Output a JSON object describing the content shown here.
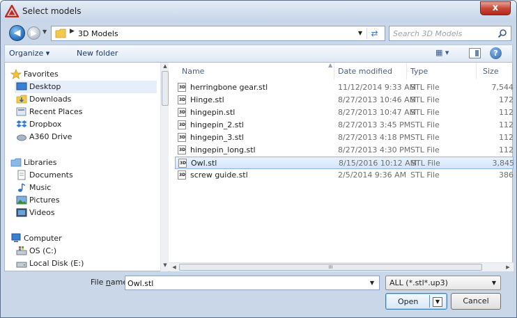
{
  "window": {
    "title": "Select models",
    "close_label": "x"
  },
  "address": {
    "path": "3D Models",
    "search_placeholder": "Search 3D Models"
  },
  "toolbar": {
    "organize_label": "Organize ▾",
    "newfolder_label": "New folder",
    "views_label": "▦ ▾"
  },
  "nav": {
    "favorites_label": "Favorites",
    "favorites": [
      "Desktop",
      "Downloads",
      "Recent Places",
      "Dropbox",
      "A360 Drive"
    ],
    "libraries_label": "Libraries",
    "libraries": [
      "Documents",
      "Music",
      "Pictures",
      "Videos"
    ],
    "computer_label": "Computer",
    "drives": [
      "OS (C:)",
      "Local Disk (E:)"
    ]
  },
  "columns": {
    "name": "Name",
    "date": "Date modified",
    "type": "Type",
    "size": "Size"
  },
  "files": [
    {
      "name": "herringbone gear.stl",
      "date": "11/12/2014 9:33 AM",
      "type": "STL File",
      "size": "7,544"
    },
    {
      "name": "Hinge.stl",
      "date": "8/27/2013 10:46 AM",
      "type": "STL File",
      "size": "172"
    },
    {
      "name": "hingepin.stl",
      "date": "8/27/2013 10:47 AM",
      "type": "STL File",
      "size": "112"
    },
    {
      "name": "hingepin_2.stl",
      "date": "8/27/2013 3:45 PM",
      "type": "STL File",
      "size": "112"
    },
    {
      "name": "hingepin_3.stl",
      "date": "8/27/2013 4:18 PM",
      "type": "STL File",
      "size": "112"
    },
    {
      "name": "hingepin_long.stl",
      "date": "8/27/2013 4:30 PM",
      "type": "STL File",
      "size": "112"
    },
    {
      "name": "Owl.stl",
      "date": "8/15/2016 10:12 AM",
      "type": "STL File",
      "size": "3,845"
    },
    {
      "name": "screw guide.stl",
      "date": "2/5/2014 9:36 AM",
      "type": "STL File",
      "size": "386"
    }
  ],
  "selected_file_index": 6,
  "hscroll_label": "III",
  "bottom": {
    "filename_label_pre": "File ",
    "filename_label_ul": "n",
    "filename_label_post": "ame:",
    "filename_value": "Owl.stl",
    "filter_value": "ALL (*.stl*.up3)",
    "open_label": "Open",
    "cancel_label": "Cancel"
  },
  "colors": {
    "selection": "#d3e5fa",
    "title_gradient_top": "#e4ecf6",
    "close_red": "#c9483a"
  }
}
